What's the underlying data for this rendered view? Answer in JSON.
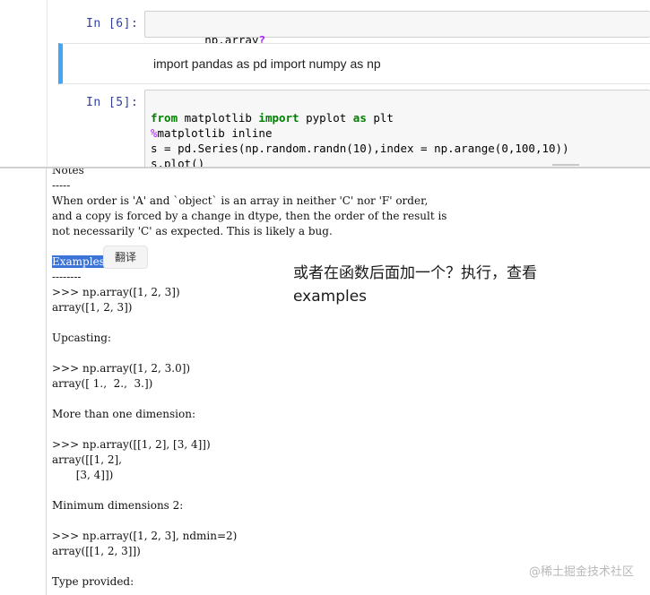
{
  "cells": {
    "cell6": {
      "prompt": "In  [6]:",
      "code_text": "np.array",
      "code_qmark": "?"
    },
    "markdown": {
      "text": "import pandas as pd import numpy as np"
    },
    "cell5": {
      "prompt": "In  [5]:",
      "line1": {
        "kw1": "from",
        "mid": " matplotlib ",
        "kw2": "import",
        "mid2": " pyplot ",
        "kw3": "as",
        "end": " plt"
      },
      "line2": {
        "magic": "%",
        "rest": "matplotlib inline"
      },
      "line3": "s = pd.Series(np.random.randn(10),index = np.arange(0,100,10))",
      "line4": "s.plot()"
    }
  },
  "pager": {
    "lines": [
      "Notes",
      "-----",
      "When order is 'A' and `object` is an array in neither 'C' nor 'F' order,",
      "and a copy is forced by a change in dtype, then the order of the result is",
      "not necessarily 'C' as expected. This is likely a bug.",
      "",
      "Examples",
      "--------",
      ">>> np.array([1, 2, 3])",
      "array([1, 2, 3])",
      "",
      "Upcasting:",
      "",
      ">>> np.array([1, 2, 3.0])",
      "array([ 1.,  2.,  3.])",
      "",
      "More than one dimension:",
      "",
      ">>> np.array([[1, 2], [3, 4]])",
      "array([[1, 2],",
      "       [3, 4]])",
      "",
      "Minimum dimensions 2:",
      "",
      ">>> np.array([1, 2, 3], ndmin=2)",
      "array([[1, 2, 3]])",
      "",
      "Type provided:"
    ],
    "translate_popup": "翻译"
  },
  "annotation": {
    "line1": "或者在函数后面加一个？执行，查看",
    "line2": "examples"
  },
  "watermark": "@稀土掘金技术社区",
  "colors": {
    "prompt": "#303f9f",
    "keyword": "#008000",
    "magic": "#aa22ff",
    "markdown_selected_bar": "#42a5f5",
    "selection": "#3b73d8"
  }
}
